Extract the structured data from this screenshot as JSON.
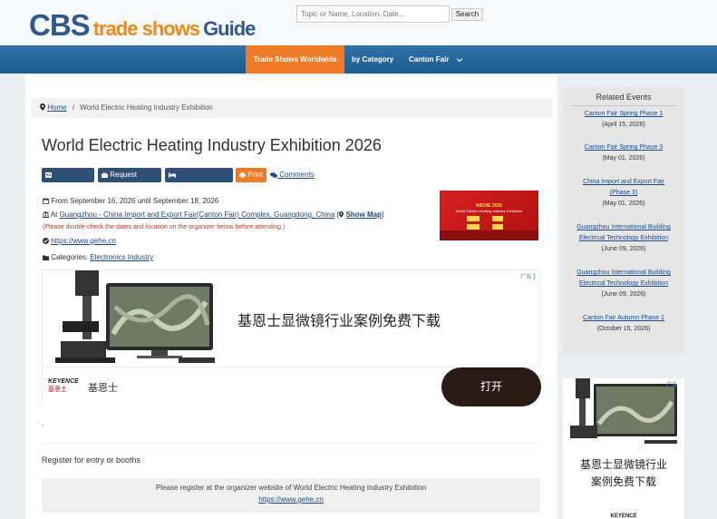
{
  "header": {
    "logo_cbs": "CBS",
    "logo_ts": "trade shows",
    "logo_guide": "Guide",
    "search_placeholder": "Topic or Name, Location, Date...",
    "search_button": "Search"
  },
  "nav": {
    "items": [
      "Trade Shows Worldwide",
      "by Category",
      "Canton Fair"
    ]
  },
  "breadcrumb": {
    "home": "Home",
    "separator": "/",
    "current": "World Electric Heating Industry Exhibition"
  },
  "event": {
    "title": "World Electric Heating Industry Exhibition 2026",
    "buttons": [
      "Registration",
      "Request Booths",
      "Accommodation",
      "Print"
    ],
    "comments": "Comments",
    "date_line": "From September 16, 2026 until September 18, 2026",
    "venue_prefix": "At",
    "venue": "Guangzhou - China Import and Export Fair(Canton Fair) Complex, Guangdong, China",
    "show_map": "Show Map",
    "warning": "(Please double-check the dates and location on the organizer below before attending.)",
    "website": "https://www.gehe.cn",
    "categories_label": "Categories:",
    "category": "Electronics Industry",
    "image_title": "WEHIE 2026",
    "image_subtitle": "World Electric Heating Industry Exhibition"
  },
  "ad": {
    "headline": "基恩士显微镜行业案例免费下载",
    "brand": "基恩士",
    "brand_logo": "KEYENCE",
    "brand_logo_cn": "基恩士",
    "button": "打开",
    "mark": "广告"
  },
  "register": {
    "dot": ".",
    "heading": "Register for entry or booths",
    "line1": "Please register at the organizer website of World Electric Heating Industry Exhibition",
    "link": "https://www.gehe.cn"
  },
  "sidebar": {
    "title": "Related Events",
    "events": [
      {
        "lines": [
          "Canton Fair Spring Phase 1"
        ],
        "date": "(April 15, 2026)"
      },
      {
        "lines": [
          "Canton Fair Spring Phase 3"
        ],
        "date": "(May 01, 2026)"
      },
      {
        "lines": [
          "China Import and Export Fair",
          "(Phase 3)"
        ],
        "date": "(May 01, 2026)"
      },
      {
        "lines": [
          "Guangzhou International Building",
          "Electrical Technology Exhibition"
        ],
        "date": "(June 09, 2026)"
      },
      {
        "lines": [
          "Guangzhou International Building",
          "Electrical Technology Exhibition"
        ],
        "date": "(June 09, 2026)"
      },
      {
        "lines": [
          "Canton Fair Autumn Phase 1"
        ],
        "date": "(October 15, 2026)"
      }
    ],
    "ad_headline_1": "基恩士显微镜行业",
    "ad_headline_2": "案例免费下载",
    "ad_mark": "广告",
    "ad_brand": "KEYENCE"
  },
  "colors": {
    "brand_blue": "#2f5b8c",
    "brand_orange": "#f28a1a",
    "nav_active": "#f07a25",
    "button_dark": "#2f5076",
    "link": "#1a4a8a",
    "warning": "#c0392b"
  }
}
